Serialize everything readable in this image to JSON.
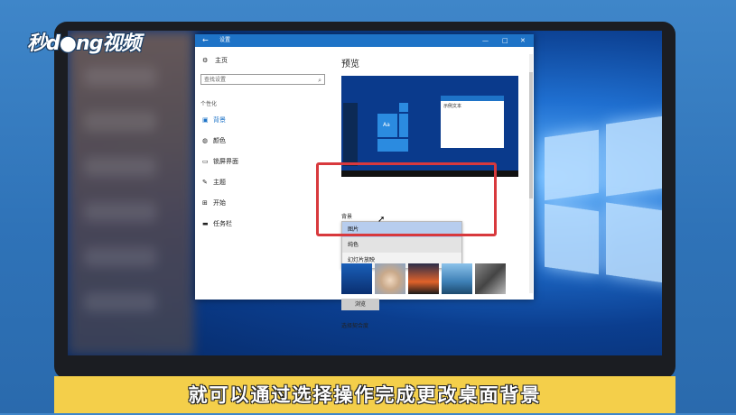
{
  "watermark": {
    "brand": "秒d●ng视频"
  },
  "window": {
    "title": "设置",
    "back": "←",
    "minimize": "—",
    "maximize": "□",
    "close": "✕"
  },
  "sidebar": {
    "home": "主页",
    "search_placeholder": "查找设置",
    "section": "个性化",
    "items": [
      {
        "label": "背景",
        "icon": "picture-icon"
      },
      {
        "label": "颜色",
        "icon": "palette-icon"
      },
      {
        "label": "锁屏界面",
        "icon": "lock-screen-icon"
      },
      {
        "label": "主题",
        "icon": "brush-icon"
      },
      {
        "label": "开始",
        "icon": "start-icon"
      },
      {
        "label": "任务栏",
        "icon": "taskbar-icon"
      }
    ]
  },
  "main": {
    "heading": "预览",
    "preview_sample_text": "示例文本",
    "preview_tile_text": "Aa",
    "background_label": "背景",
    "dropdown_options": [
      "图片",
      "纯色",
      "幻灯片放映"
    ],
    "selected_option": "图片",
    "browse_button": "浏览",
    "fit_label": "选择契合度"
  },
  "caption": "就可以通过选择操作完成更改桌面背景"
}
